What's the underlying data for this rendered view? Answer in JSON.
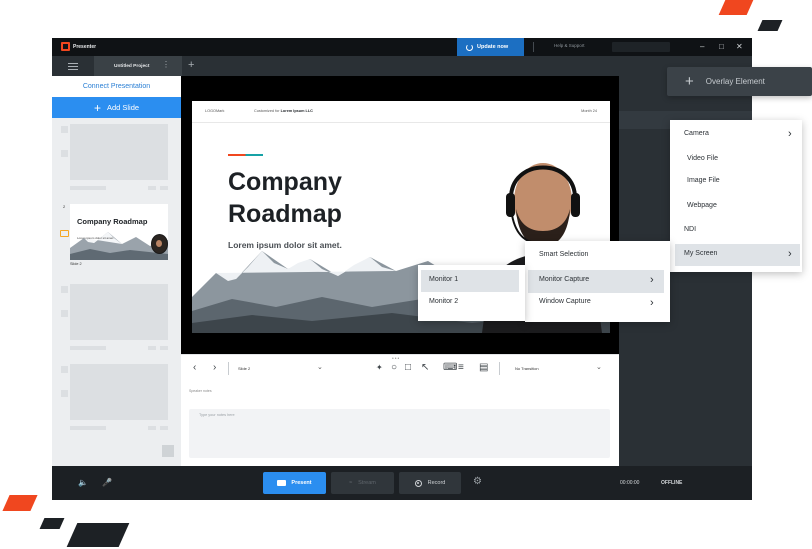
{
  "app": {
    "name": "Presenter",
    "update_label": "Update now",
    "help_label": "Help & Support",
    "project_tab": "Untitled Project"
  },
  "sidebar": {
    "connect_label": "Connect Presentation",
    "add_slide_label": "Add Slide",
    "active_slide_number": "2",
    "active_slide_label": "Slide 2"
  },
  "slide": {
    "header_left": "LOGOMark",
    "header_mid_prefix": "Customized for",
    "header_mid_bold": "Lorem Ipsum LLC",
    "header_right": "Month 24",
    "title": "Company Roadmap",
    "subtitle": "Lorem ipsum dolor sit amet."
  },
  "toolbar": {
    "slide_select": "Slide 2",
    "transition_select": "No Transition"
  },
  "notes": {
    "label": "Speaker notes",
    "placeholder": "Type your notes here"
  },
  "bottom": {
    "present": "Present",
    "stream": "Stream",
    "record": "Record",
    "timer": "00:00:00",
    "status": "OFFLINE"
  },
  "overlay": {
    "button_label": "Overlay Element",
    "menu": [
      "Camera",
      "Video File",
      "Image File",
      "Webpage",
      "NDI",
      "My Screen"
    ],
    "screen_menu": [
      "Smart Selection",
      "Monitor Capture",
      "Window Capture"
    ],
    "monitor_menu": [
      "Monitor 1",
      "Monitor 2"
    ]
  },
  "colors": {
    "accent_blue": "#2b8ef0",
    "brand_orange": "#f0471f",
    "dark_bg": "#22272b"
  }
}
